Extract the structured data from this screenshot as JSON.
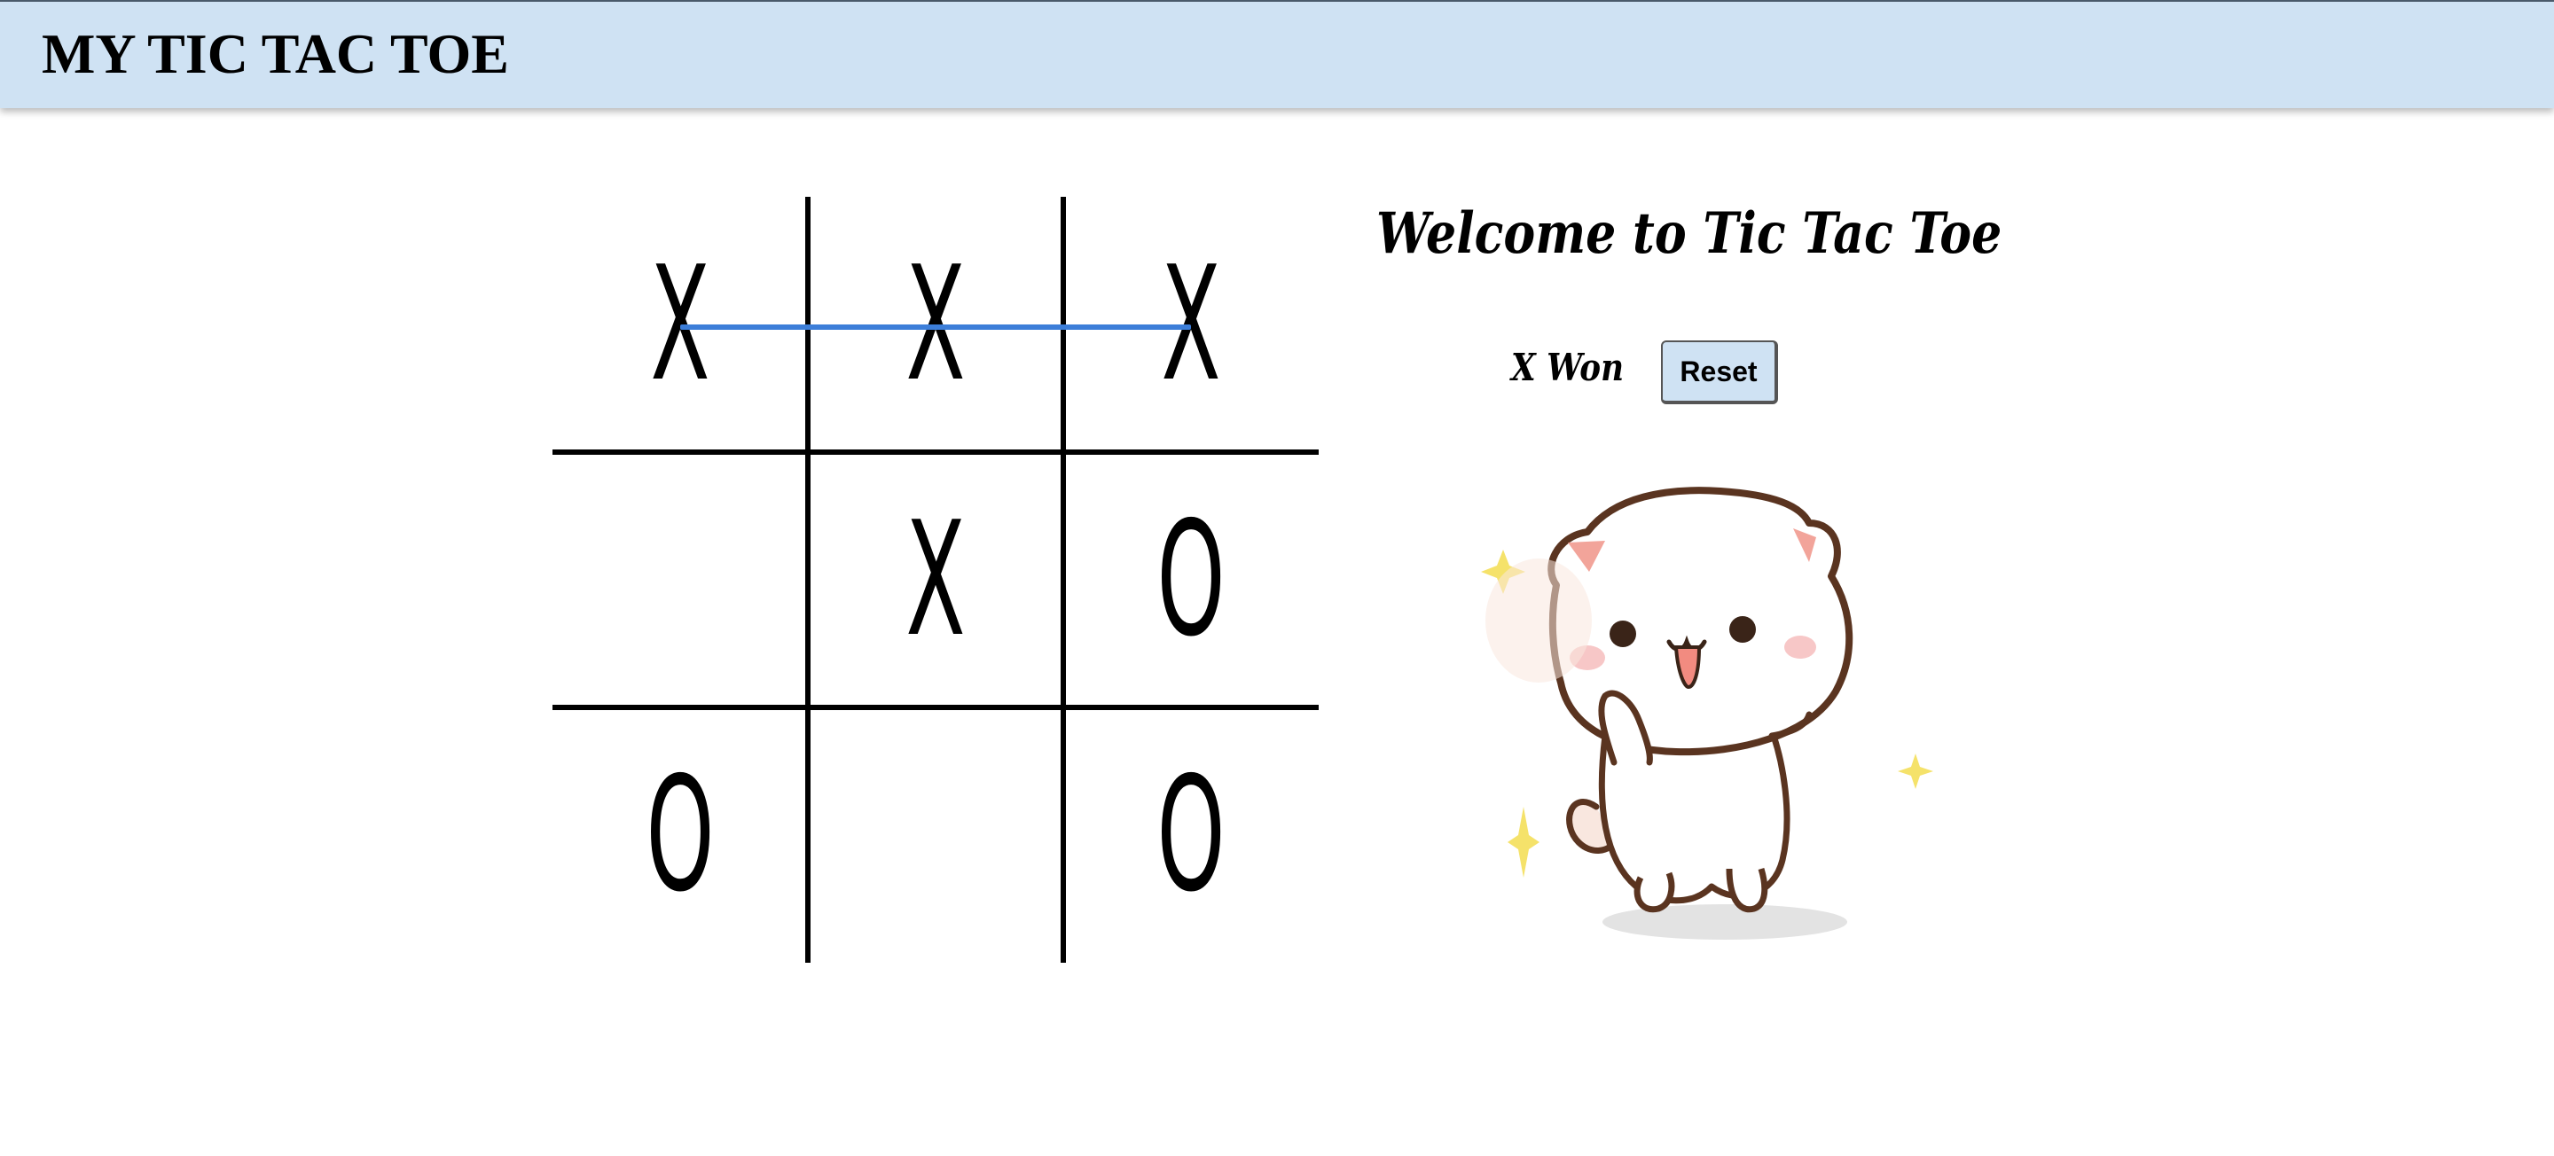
{
  "header": {
    "title": "MY TIC TAC TOE"
  },
  "board": {
    "cells": [
      "X",
      "X",
      "X",
      "",
      "X",
      "O",
      "O",
      "",
      "O"
    ],
    "winning_line": {
      "row": 0
    }
  },
  "side": {
    "welcome": "Welcome to Tic Tac Toe",
    "status": "X Won",
    "reset_label": "Reset",
    "mascot_icon": "cute-cat-dancing-icon"
  },
  "colors": {
    "navbar_bg": "#cfe2f3",
    "button_bg": "#cfe2f3",
    "win_line": "#3c7ed9",
    "grid": "#000000"
  }
}
